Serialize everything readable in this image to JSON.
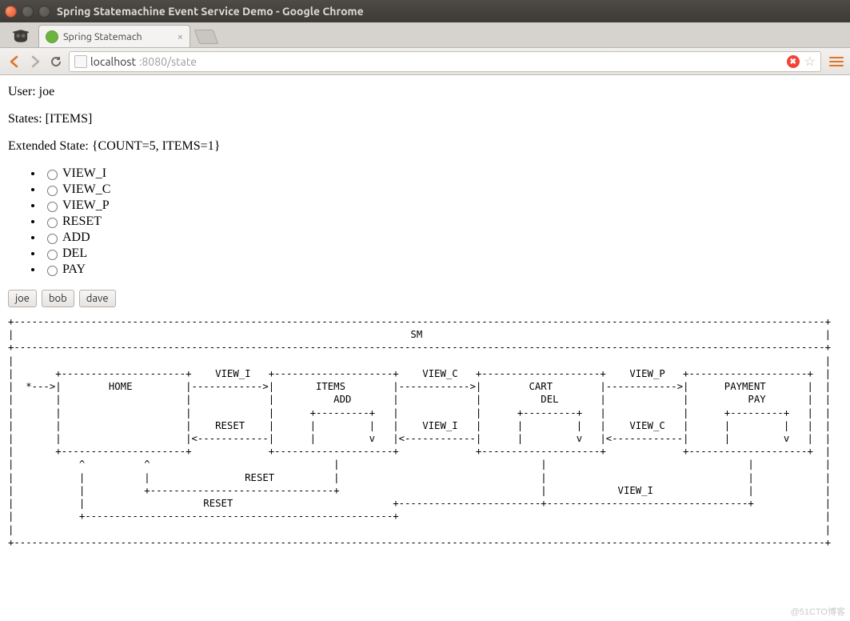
{
  "window": {
    "title": "Spring Statemachine Event Service Demo - Google Chrome"
  },
  "tab": {
    "title": "Spring Statemach"
  },
  "url": {
    "host": "localhost",
    "rest": ":8080/state"
  },
  "content": {
    "user_line": "User: joe",
    "states_line": "States: [ITEMS]",
    "ext_state_line": "Extended State: {COUNT=5, ITEMS=1}",
    "radios": [
      "VIEW_I",
      "VIEW_C",
      "VIEW_P",
      "RESET",
      "ADD",
      "DEL",
      "PAY"
    ],
    "buttons": [
      "joe",
      "bob",
      "dave"
    ],
    "ascii": "+-----------------------------------------------------------------------------------------------------------------------------------------+\n|                                                                   SM                                                                    |\n+-----------------------------------------------------------------------------------------------------------------------------------------+\n|                                                                                                                                         |\n|       +---------------------+    VIEW_I   +--------------------+    VIEW_C   +--------------------+    VIEW_P   +--------------------+  |\n|  *--->|        HOME         |------------>|       ITEMS        |------------>|        CART        |------------>|      PAYMENT       |  |\n|       |                     |             |          ADD       |             |          DEL       |             |          PAY       |  |\n|       |                     |             |      +---------+   |             |      +---------+   |             |      +---------+   |  |\n|       |                     |    RESET    |      |         |   |    VIEW_I   |      |         |   |    VIEW_C   |      |         |   |  |\n|       |                     |<------------|      |         v   |<------------|      |         v   |<------------|      |         v   |  |\n|       +---------------------+             +--------------------+             +--------------------+             +--------------------+  |\n|           ^          ^                               |                                  |                                  |            |\n|           |          |                RESET          |                                  |                                  |            |\n|           |          +-------------------------------+                                  |            VIEW_I                |            |\n|           |                    RESET                           +------------------------+----------------------------------+            |\n|           +----------------------------------------------------+                                                                        |\n|                                                                                                                                         |\n+-----------------------------------------------------------------------------------------------------------------------------------------+"
  },
  "watermark": "@51CTO博客"
}
